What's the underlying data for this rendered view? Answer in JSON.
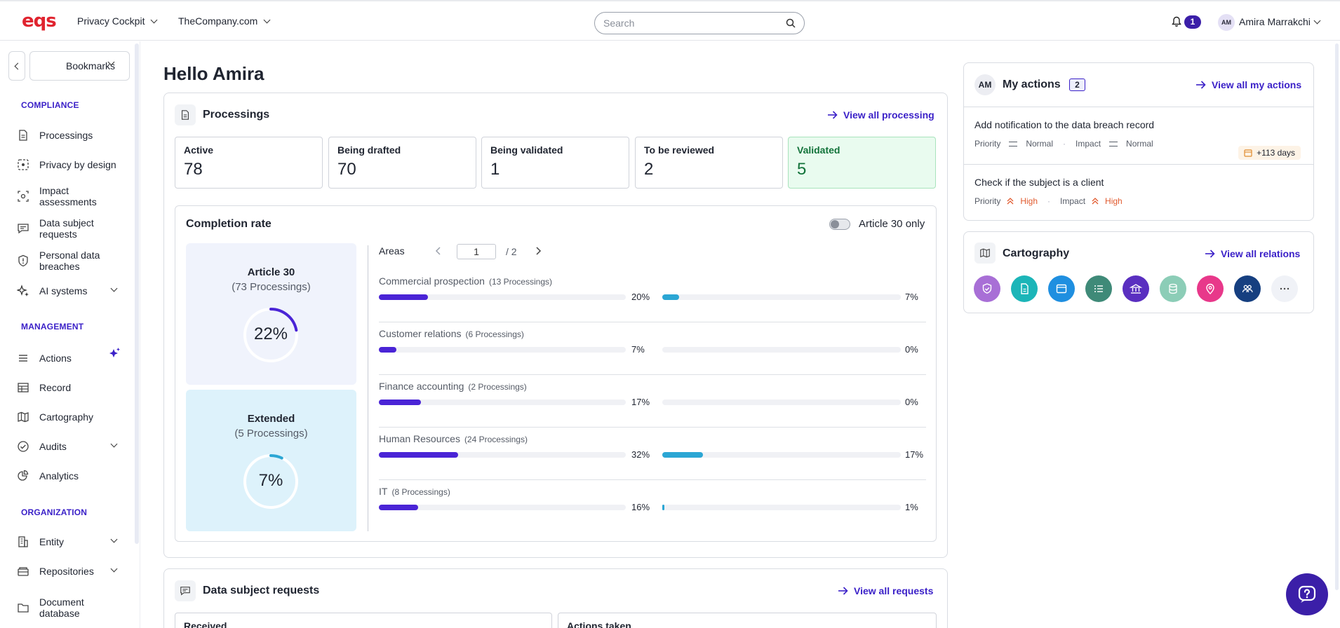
{
  "header": {
    "logo": "eqs",
    "nav": [
      {
        "label": "Privacy Cockpit"
      },
      {
        "label": "TheCompany.com"
      }
    ],
    "search_placeholder": "Search",
    "notifications_count": "1",
    "user_initials": "AM",
    "user_name": "Amira Marrakchi"
  },
  "sidebar": {
    "bookmarks_label": "Bookmarks",
    "sections": {
      "compliance": "COMPLIANCE",
      "management": "MANAGEMENT",
      "organization": "ORGANIZATION"
    },
    "items": {
      "processings": "Processings",
      "privacy_by_design": "Privacy by design",
      "impact_assessments": "Impact assessments",
      "data_subject_requests": "Data subject requests",
      "personal_data_breaches": "Personal data breaches",
      "ai_systems": "AI systems",
      "actions": "Actions",
      "record": "Record",
      "cartography": "Cartography",
      "audits": "Audits",
      "analytics": "Analytics",
      "entity": "Entity",
      "repositories": "Repositories",
      "document_database": "Document database"
    }
  },
  "main": {
    "greeting": "Hello Amira",
    "processings": {
      "title": "Processings",
      "view_all": "View all processing",
      "stats": [
        {
          "label": "Active",
          "value": "78"
        },
        {
          "label": "Being drafted",
          "value": "70"
        },
        {
          "label": "Being validated",
          "value": "1"
        },
        {
          "label": "To be reviewed",
          "value": "2"
        },
        {
          "label": "Validated",
          "value": "5"
        }
      ]
    },
    "completion": {
      "title": "Completion rate",
      "toggle_label": "Article 30 only",
      "article30": {
        "title": "Article 30",
        "subtitle": "(73 Processings)",
        "value": "22%",
        "fraction": 0.22
      },
      "extended": {
        "title": "Extended",
        "subtitle": "(5 Processings)",
        "value": "7%",
        "fraction": 0.07
      },
      "areas_label": "Areas",
      "page_current": "1",
      "page_total": "/ 2",
      "areas": [
        {
          "name": "Commercial prospection",
          "count": "(13 Processings)",
          "art30": 0.2,
          "art30_label": "20%",
          "ext": 0.07,
          "ext_label": "7%"
        },
        {
          "name": "Customer relations",
          "count": "(6 Processings)",
          "art30": 0.07,
          "art30_label": "7%",
          "ext": 0.0,
          "ext_label": "0%"
        },
        {
          "name": "Finance accounting",
          "count": "(2 Processings)",
          "art30": 0.17,
          "art30_label": "17%",
          "ext": 0.0,
          "ext_label": "0%"
        },
        {
          "name": "Human Resources",
          "count": "(24 Processings)",
          "art30": 0.32,
          "art30_label": "32%",
          "ext": 0.17,
          "ext_label": "17%"
        },
        {
          "name": "IT",
          "count": "(8 Processings)",
          "art30": 0.16,
          "art30_label": "16%",
          "ext": 0.01,
          "ext_label": "1%"
        }
      ]
    },
    "dsr": {
      "title": "Data subject requests",
      "view_all": "View all requests",
      "boxes": [
        "Received",
        "Actions taken"
      ]
    }
  },
  "right": {
    "actions": {
      "initials": "AM",
      "title": "My actions",
      "count": "2",
      "view_all": "View all my actions",
      "items": [
        {
          "title": "Add notification to the data breach record",
          "priority_label": "Priority",
          "priority": "Normal",
          "impact_label": "Impact",
          "impact": "Normal",
          "due": "+113 days"
        },
        {
          "title": "Check if the subject is a client",
          "priority_label": "Priority",
          "priority": "High",
          "impact_label": "Impact",
          "impact": "High"
        }
      ]
    },
    "cartography": {
      "title": "Cartography",
      "view_all": "View all relations",
      "icons": [
        {
          "name": "shield-check-icon",
          "color": "#a86fd6"
        },
        {
          "name": "document-icon",
          "color": "#1cb5b8"
        },
        {
          "name": "window-icon",
          "color": "#1f8fe0"
        },
        {
          "name": "list-icon",
          "color": "#3f8a78"
        },
        {
          "name": "bank-icon",
          "color": "#5a2fc0"
        },
        {
          "name": "database-icon",
          "color": "#8ccdb7"
        },
        {
          "name": "location-pin-icon",
          "color": "#e8388a"
        },
        {
          "name": "people-icon",
          "color": "#163f80"
        },
        {
          "name": "more-icon",
          "color": "#f0f2f7"
        }
      ]
    }
  },
  "colors": {
    "accent": "#3b21c8",
    "bar_art30": "#4a24d6",
    "bar_ext": "#2ba6d4",
    "validated_bg": "#e9fbef"
  }
}
